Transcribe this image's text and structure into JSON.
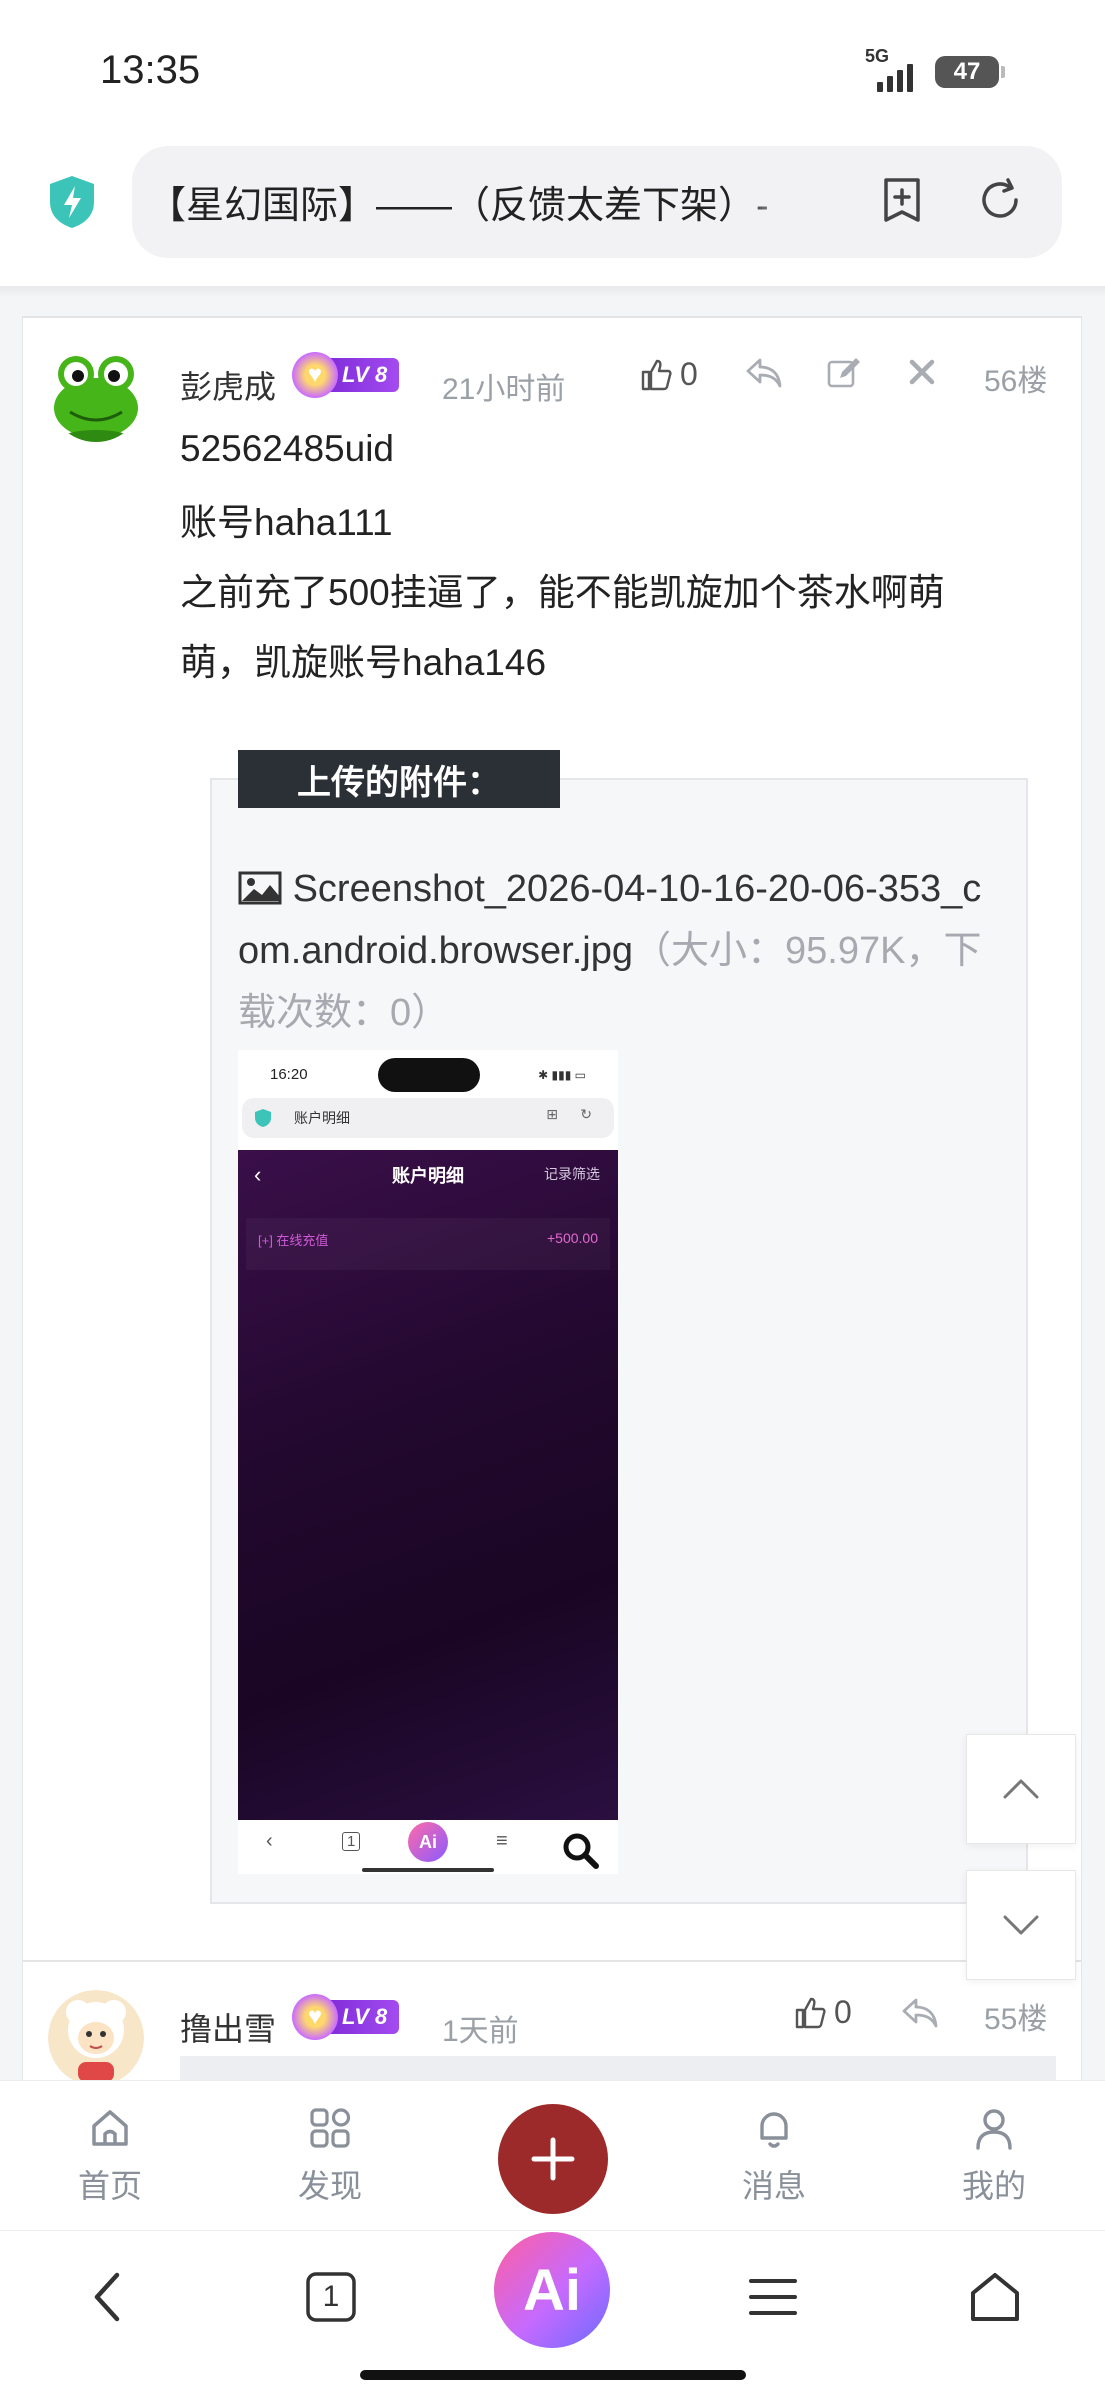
{
  "status_bar": {
    "time": "13:35",
    "network": "5G",
    "battery": "47"
  },
  "browser": {
    "url_title": "【星幻国际】——（反馈太差下架）-"
  },
  "post56": {
    "username": "彭虎成",
    "level": "LV 8",
    "time": "21小时前",
    "likes": "0",
    "floor": "56楼",
    "lines": [
      "52562485uid",
      "账号haha111",
      "之前充了500挂逼了，能不能凯旋加个茶水啊萌萌，凯旋账号haha146"
    ],
    "attachment_label": "上传的附件：",
    "file_name": "Screenshot_2026-04-10-16-20-06-353_com.android.browser.jpg",
    "file_meta": "（大小：95.97K，下载次数：0）",
    "embedded": {
      "time": "16:20",
      "url_title": "账户明细",
      "page_title": "账户明细",
      "filter": "记录筛选",
      "row_label": "[+] 在线充值",
      "row_amount": "+500.00",
      "ai": "Ai",
      "tab": "1"
    }
  },
  "post55": {
    "username": "撸出雪",
    "level": "LV 8",
    "time": "1天前",
    "likes": "0",
    "floor": "55楼"
  },
  "site_nav": {
    "home": "首页",
    "discover": "发现",
    "messages": "消息",
    "mine": "我的"
  },
  "browser_bar": {
    "ai": "Ai",
    "tabs_count": "1"
  },
  "colors": {
    "accent_red": "#9c2a2a",
    "level_purple": "#8a36e0",
    "shield_teal": "#3cc4b8"
  }
}
